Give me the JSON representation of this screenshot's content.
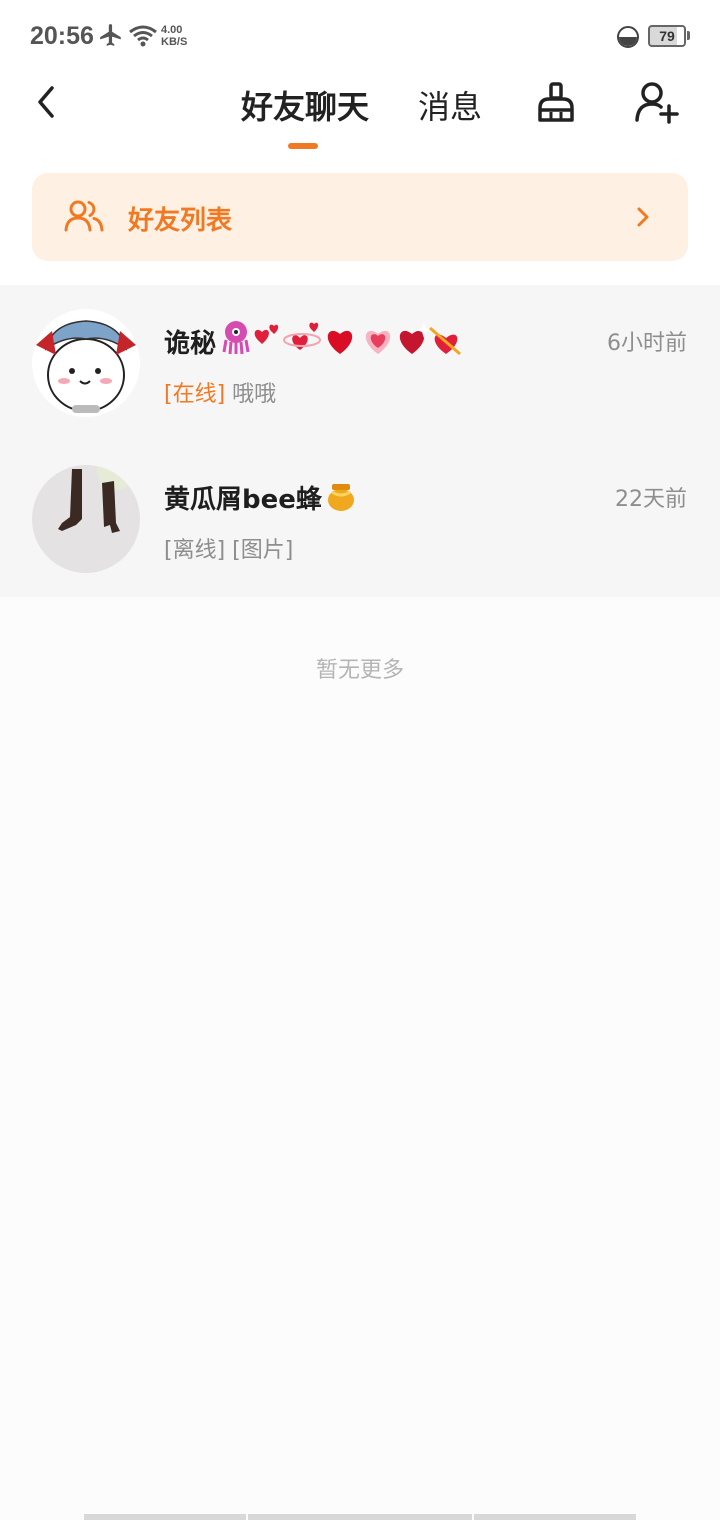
{
  "status_bar": {
    "time": "20:56",
    "net_speed_value": "4.00",
    "net_speed_unit": "KB/S",
    "battery": "79",
    "icons": [
      "airplane-icon",
      "wifi-icon",
      "data-saver-icon",
      "battery-icon"
    ]
  },
  "header": {
    "tabs": [
      {
        "label": "好友聊天",
        "active": true
      },
      {
        "label": "消息",
        "active": false
      }
    ],
    "accent_color": "#f07a23",
    "icons": [
      "back-arrow-icon",
      "clean-broom-icon",
      "add-friend-icon"
    ]
  },
  "friend_list": {
    "label": "好友列表",
    "icon": "friends-icon",
    "arrow": "chevron-right-icon"
  },
  "chats": [
    {
      "name": "诡秘",
      "emoji_icons": [
        "octopus-emoji",
        "two-hearts-emoji",
        "revolving-hearts-emoji",
        "heart-emoji",
        "growing-heart-emoji",
        "sparkling-heart-emoji",
        "heart-with-arrow-emoji"
      ],
      "time": "6小时前",
      "status": "[在线]",
      "message": "哦哦"
    },
    {
      "name": "黄瓜屑bee蜂",
      "emoji_icons": [
        "honey-pot-emoji"
      ],
      "time": "22天前",
      "status": "[离线]",
      "message": "[图片]"
    }
  ],
  "footer": {
    "no_more": "暂无更多"
  }
}
